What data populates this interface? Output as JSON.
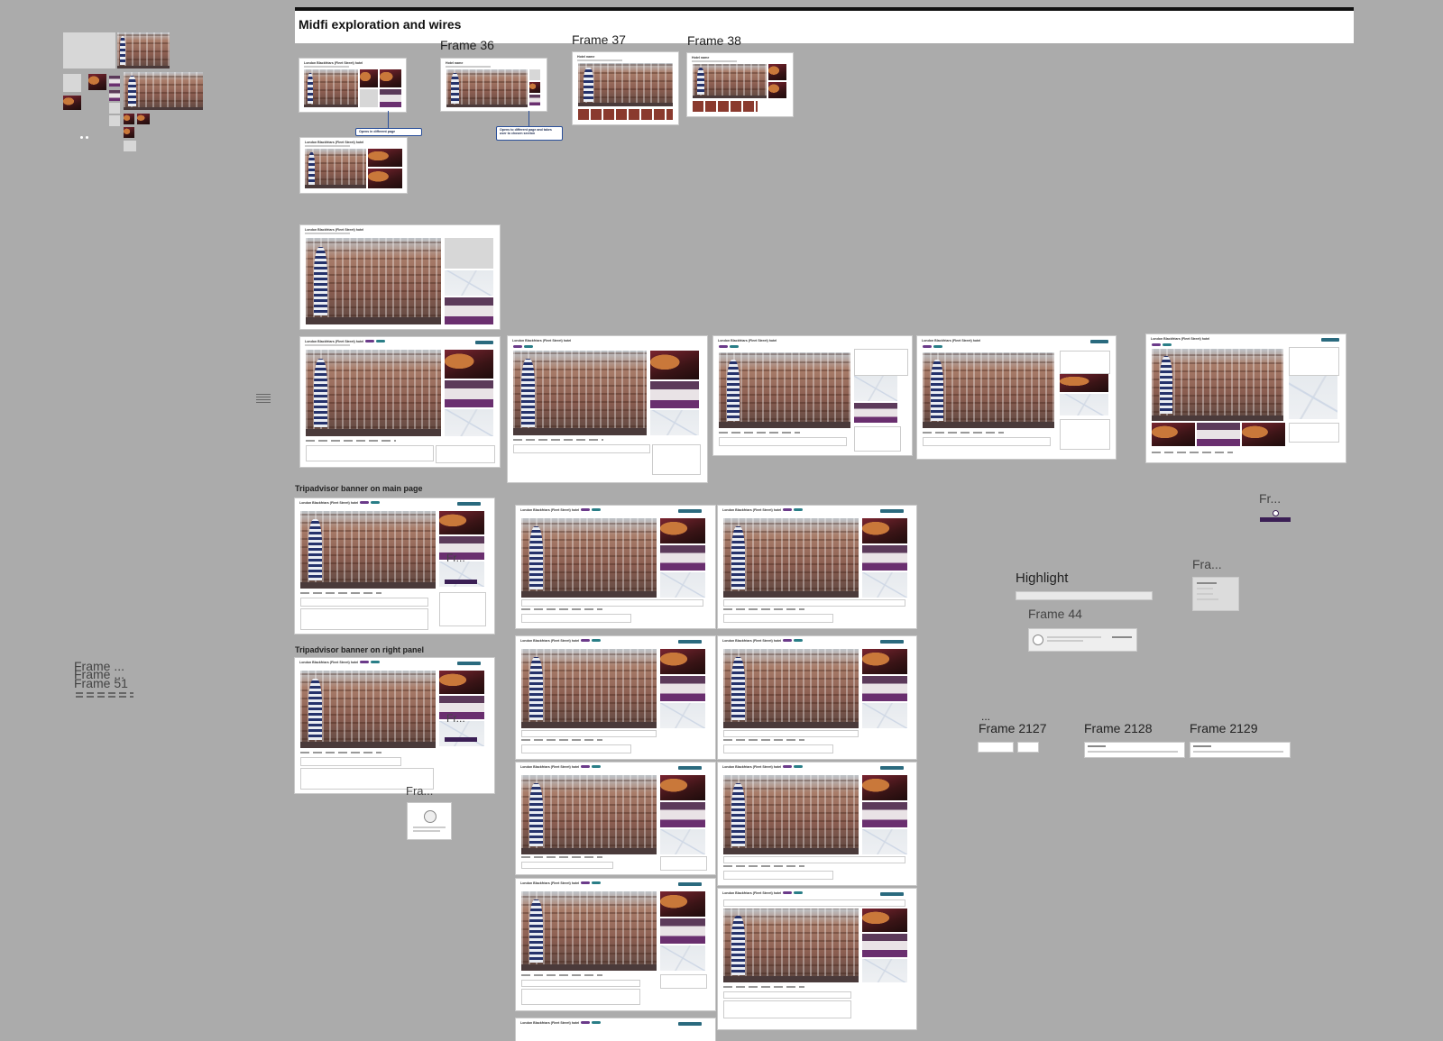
{
  "canvas": {
    "section_title": "Midfi exploration and wires"
  },
  "frames": {
    "frame36": "Frame 36",
    "frame37": "Frame 37",
    "frame38": "Frame 38",
    "frame44": "Frame 44",
    "frame2127": "Frame 2127",
    "frame2128": "Frame 2128",
    "frame2129": "Frame 2129",
    "frame51": "Frame 51",
    "frame_trunc_a": "Frame ...",
    "frame_trunc_b": "Fra...",
    "frame_trunc_c": "Fr...",
    "frame_trunc_d": "Fra..."
  },
  "labels": {
    "highlight": "Highlight",
    "tripadvisor_main": "Tripadvisor banner on main page",
    "tripadvisor_right": "Tripadvisor banner on right panel",
    "ellipsis": "..."
  },
  "notes": {
    "open_page": "Opens in different page",
    "open_page_section": "Opens to different page and takes user to chosen section"
  },
  "hotel": {
    "name": "London Blackfriars (Fleet Street) hotel",
    "placeholder_name": "Hotel name"
  }
}
